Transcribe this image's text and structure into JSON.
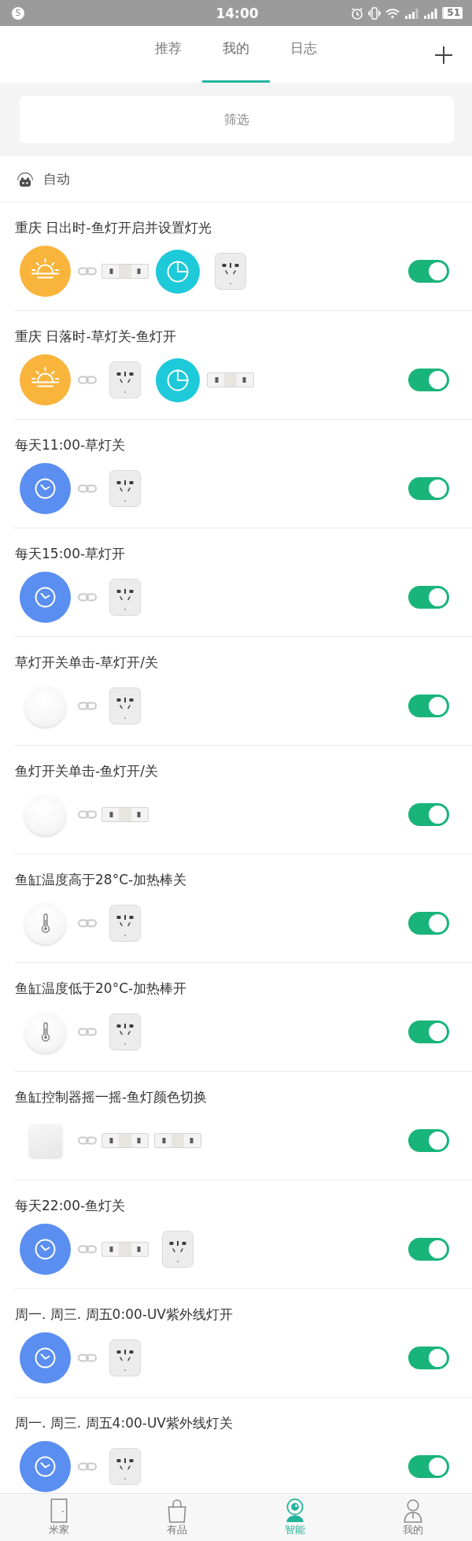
{
  "status_bar": {
    "notifications": "5",
    "time": "14:00",
    "battery": "51"
  },
  "tabs": [
    {
      "label": "推荐",
      "selected": false
    },
    {
      "label": "我的",
      "selected": true
    },
    {
      "label": "日志",
      "selected": false
    }
  ],
  "filter": {
    "label": "筛选"
  },
  "section": {
    "title": "自动"
  },
  "automations": [
    {
      "title": "重庆 日出时-鱼灯开启并设置灯光",
      "enabled": true,
      "trigger": {
        "kind": "sunrise"
      },
      "actions": [
        {
          "kind": "strip"
        },
        {
          "kind": "timer"
        },
        {
          "kind": "socket"
        }
      ]
    },
    {
      "title": "重庆 日落时-草灯关-鱼灯开",
      "enabled": true,
      "trigger": {
        "kind": "sunrise"
      },
      "actions": [
        {
          "kind": "socket"
        },
        {
          "kind": "timer"
        },
        {
          "kind": "strip"
        }
      ]
    },
    {
      "title": "每天11:00-草灯关",
      "enabled": true,
      "trigger": {
        "kind": "clock"
      },
      "actions": [
        {
          "kind": "socket"
        }
      ]
    },
    {
      "title": "每天15:00-草灯开",
      "enabled": true,
      "trigger": {
        "kind": "clock"
      },
      "actions": [
        {
          "kind": "socket"
        }
      ]
    },
    {
      "title": "草灯开关单击-草灯开/关",
      "enabled": true,
      "trigger": {
        "kind": "button"
      },
      "actions": [
        {
          "kind": "socket"
        }
      ]
    },
    {
      "title": "鱼灯开关单击-鱼灯开/关",
      "enabled": true,
      "trigger": {
        "kind": "button"
      },
      "actions": [
        {
          "kind": "strip"
        }
      ]
    },
    {
      "title": "鱼缸温度高于28°C-加热棒关",
      "enabled": true,
      "trigger": {
        "kind": "sensor"
      },
      "actions": [
        {
          "kind": "socket"
        }
      ]
    },
    {
      "title": "鱼缸温度低于20°C-加热棒开",
      "enabled": true,
      "trigger": {
        "kind": "sensor"
      },
      "actions": [
        {
          "kind": "socket"
        }
      ]
    },
    {
      "title": "鱼缸控制器摇一摇-鱼灯颜色切换",
      "enabled": true,
      "trigger": {
        "kind": "cube"
      },
      "actions": [
        {
          "kind": "strip"
        },
        {
          "kind": "strip"
        }
      ]
    },
    {
      "title": "每天22:00-鱼灯关",
      "enabled": true,
      "trigger": {
        "kind": "clock"
      },
      "actions": [
        {
          "kind": "strip"
        },
        {
          "kind": "socket"
        }
      ]
    },
    {
      "title": "周一. 周三. 周五0:00-UV紫外线灯开",
      "enabled": true,
      "trigger": {
        "kind": "clock"
      },
      "actions": [
        {
          "kind": "socket"
        }
      ]
    },
    {
      "title": "周一. 周三. 周五4:00-UV紫外线灯关",
      "enabled": true,
      "trigger": {
        "kind": "clock"
      },
      "actions": [
        {
          "kind": "socket"
        }
      ]
    }
  ],
  "bottom_nav": [
    {
      "label": "米家",
      "kind": "door",
      "selected": false
    },
    {
      "label": "有品",
      "kind": "bag",
      "selected": false
    },
    {
      "label": "智能",
      "kind": "camera",
      "selected": true
    },
    {
      "label": "我的",
      "kind": "person",
      "selected": false
    }
  ]
}
